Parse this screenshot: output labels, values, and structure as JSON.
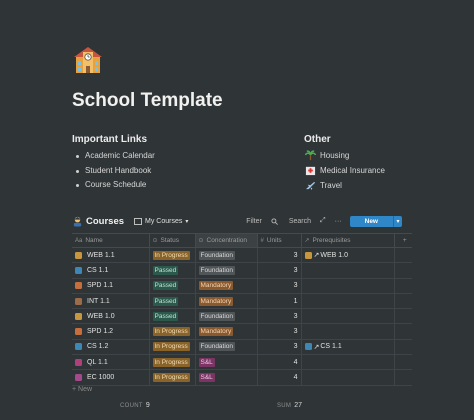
{
  "page": {
    "icon": "school-emoji",
    "title": "School Template"
  },
  "important_links": {
    "heading": "Important Links",
    "items": [
      "Academic Calendar",
      "Student Handbook",
      "Course Schedule"
    ]
  },
  "other": {
    "heading": "Other",
    "items": [
      {
        "icon": "palm-tree-emoji",
        "label": "Housing"
      },
      {
        "icon": "hospital-emoji",
        "label": "Medical Insurance"
      },
      {
        "icon": "airplane-emoji",
        "label": "Travel"
      }
    ]
  },
  "database": {
    "icon": "teacher-emoji",
    "title": "Courses",
    "view": "My Courses",
    "actions": {
      "filter": "Filter",
      "search": "Search",
      "new": "New"
    },
    "columns": [
      "Name",
      "Status",
      "Concentration",
      "Units",
      "Prerequisites"
    ],
    "rows": [
      {
        "name": "WEB 1.1",
        "name_color": "#c6973f",
        "status": "In Progress",
        "concentration": "Foundation",
        "units": "3",
        "prereq": "WEB 1.0",
        "prereq_color": "#c6973f"
      },
      {
        "name": "CS 1.1",
        "name_color": "#3d87b5",
        "status": "Passed",
        "concentration": "Foundation",
        "units": "3",
        "prereq": "",
        "prereq_color": ""
      },
      {
        "name": "SPD 1.1",
        "name_color": "#c46f3d",
        "status": "Passed",
        "concentration": "Mandatory",
        "units": "3",
        "prereq": "",
        "prereq_color": ""
      },
      {
        "name": "INT 1.1",
        "name_color": "#9c6b4a",
        "status": "Passed",
        "concentration": "Mandatory",
        "units": "1",
        "prereq": "",
        "prereq_color": ""
      },
      {
        "name": "WEB 1.0",
        "name_color": "#c6973f",
        "status": "Passed",
        "concentration": "Foundation",
        "units": "3",
        "prereq": "",
        "prereq_color": ""
      },
      {
        "name": "SPD 1.2",
        "name_color": "#c46f3d",
        "status": "In Progress",
        "concentration": "Mandatory",
        "units": "3",
        "prereq": "",
        "prereq_color": ""
      },
      {
        "name": "CS 1.2",
        "name_color": "#3d87b5",
        "status": "In Progress",
        "concentration": "Foundation",
        "units": "3",
        "prereq": "CS 1.1",
        "prereq_color": "#3d87b5"
      },
      {
        "name": "QL 1.1",
        "name_color": "#b0407b",
        "status": "In Progress",
        "concentration": "S&L",
        "units": "4",
        "prereq": "",
        "prereq_color": ""
      },
      {
        "name": "EC 1000",
        "name_color": "#a24a8c",
        "status": "In Progress",
        "concentration": "S&L",
        "units": "4",
        "prereq": "",
        "prereq_color": ""
      }
    ],
    "new_row_label": "New",
    "footer": {
      "count_label": "COUNT",
      "count": "9",
      "sum_label": "SUM",
      "sum": "27"
    }
  },
  "tag_colors": {
    "In Progress": {
      "bg": "#89632a",
      "fg": "#f0ddb5"
    },
    "Passed": {
      "bg": "#2b594c",
      "fg": "#bfe3d4"
    },
    "Foundation": {
      "bg": "#505558",
      "fg": "#d9d9d7"
    },
    "Mandatory": {
      "bg": "#8a5a2e",
      "fg": "#f2d3b3"
    },
    "S&L": {
      "bg": "#7a3565",
      "fg": "#f0c9e3"
    }
  }
}
